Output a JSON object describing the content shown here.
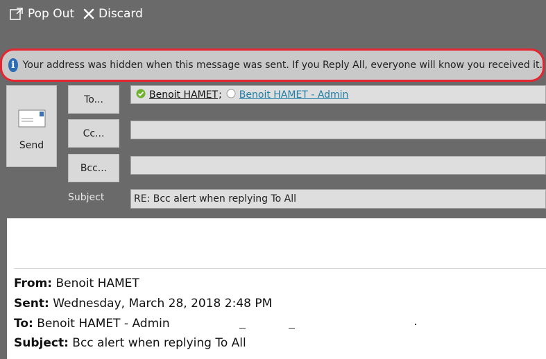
{
  "toolbar": {
    "popout_label": "Pop Out",
    "discard_label": "Discard"
  },
  "infobar": {
    "message": "Your address was hidden when this message was sent. If you Reply All, everyone will know you received it."
  },
  "compose": {
    "send_label": "Send",
    "to_label": "To...",
    "cc_label": "Cc...",
    "bcc_label": "Bcc...",
    "subject_label": "Subject",
    "to_recipients": [
      {
        "name": "Benoit HAMET",
        "separator": ";",
        "status": "resolved"
      },
      {
        "name": "Benoit HAMET - Admin",
        "status": "unresolved"
      }
    ],
    "cc_value": "",
    "bcc_value": "",
    "subject_value": "RE: Bcc alert when replying To All"
  },
  "body": {
    "from_label": "From:",
    "from_value": "Benoit HAMET",
    "sent_label": "Sent:",
    "sent_value": "Wednesday, March 28, 2018 2:48 PM",
    "to_label": "To:",
    "to_value": "Benoit HAMET - Admin",
    "subject_label": "Subject:",
    "subject_value": "Bcc alert when replying To All"
  },
  "colors": {
    "background": "#6a6a6a",
    "infobar_border": "#e5252f",
    "info_icon": "#2d6db6",
    "resolved_icon": "#6fb22f",
    "link": "#1f7ea6"
  },
  "icons": {
    "popout": "popout-icon",
    "discard": "close-icon",
    "info": "info-icon",
    "send": "envelope-icon",
    "resolved": "checkmark-circle-icon",
    "unresolved": "empty-circle-icon"
  }
}
